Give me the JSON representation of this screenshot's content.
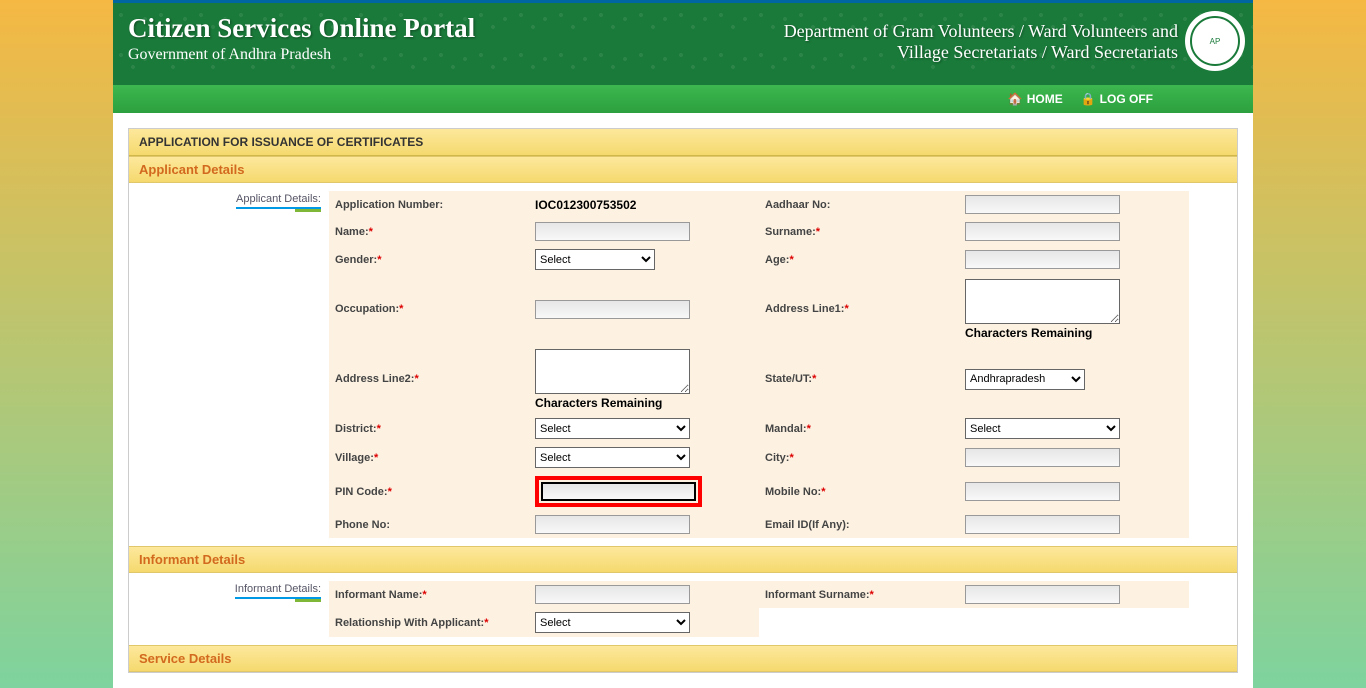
{
  "header": {
    "portal_title": "Citizen Services Online Portal",
    "portal_subtitle": "Government of Andhra Pradesh",
    "dept_line1": "Department of Gram Volunteers / Ward Volunteers and",
    "dept_line2": "Village Secretariats / Ward Secretariats"
  },
  "nav": {
    "home": "HOME",
    "logoff": "LOG OFF"
  },
  "panel": {
    "title": "APPLICATION FOR ISSUANCE OF CERTIFICATES"
  },
  "sections": {
    "applicant": "Applicant Details",
    "informant": "Informant Details",
    "service": "Service Details"
  },
  "tabs": {
    "applicant": "Applicant Details:",
    "informant": "Informant Details:"
  },
  "labels": {
    "app_number": "Application Number:",
    "aadhaar": "Aadhaar No:",
    "name": "Name:",
    "surname": "Surname:",
    "gender": "Gender:",
    "age": "Age:",
    "occupation": "Occupation:",
    "address1": "Address Line1:",
    "address2": "Address Line2:",
    "state": "State/UT:",
    "district": "District:",
    "mandal": "Mandal:",
    "village": "Village:",
    "city": "City:",
    "pin": "PIN Code:",
    "mobile": "Mobile No:",
    "phone": "Phone No:",
    "email": "Email ID(If Any):",
    "informant_name": "Informant Name:",
    "informant_surname": "Informant Surname:",
    "relationship": "Relationship With Applicant:",
    "chars_remaining": "Characters Remaining"
  },
  "values": {
    "app_number": "IOC012300753502",
    "select_placeholder": "Select",
    "state_value": "Andhrapradesh"
  }
}
